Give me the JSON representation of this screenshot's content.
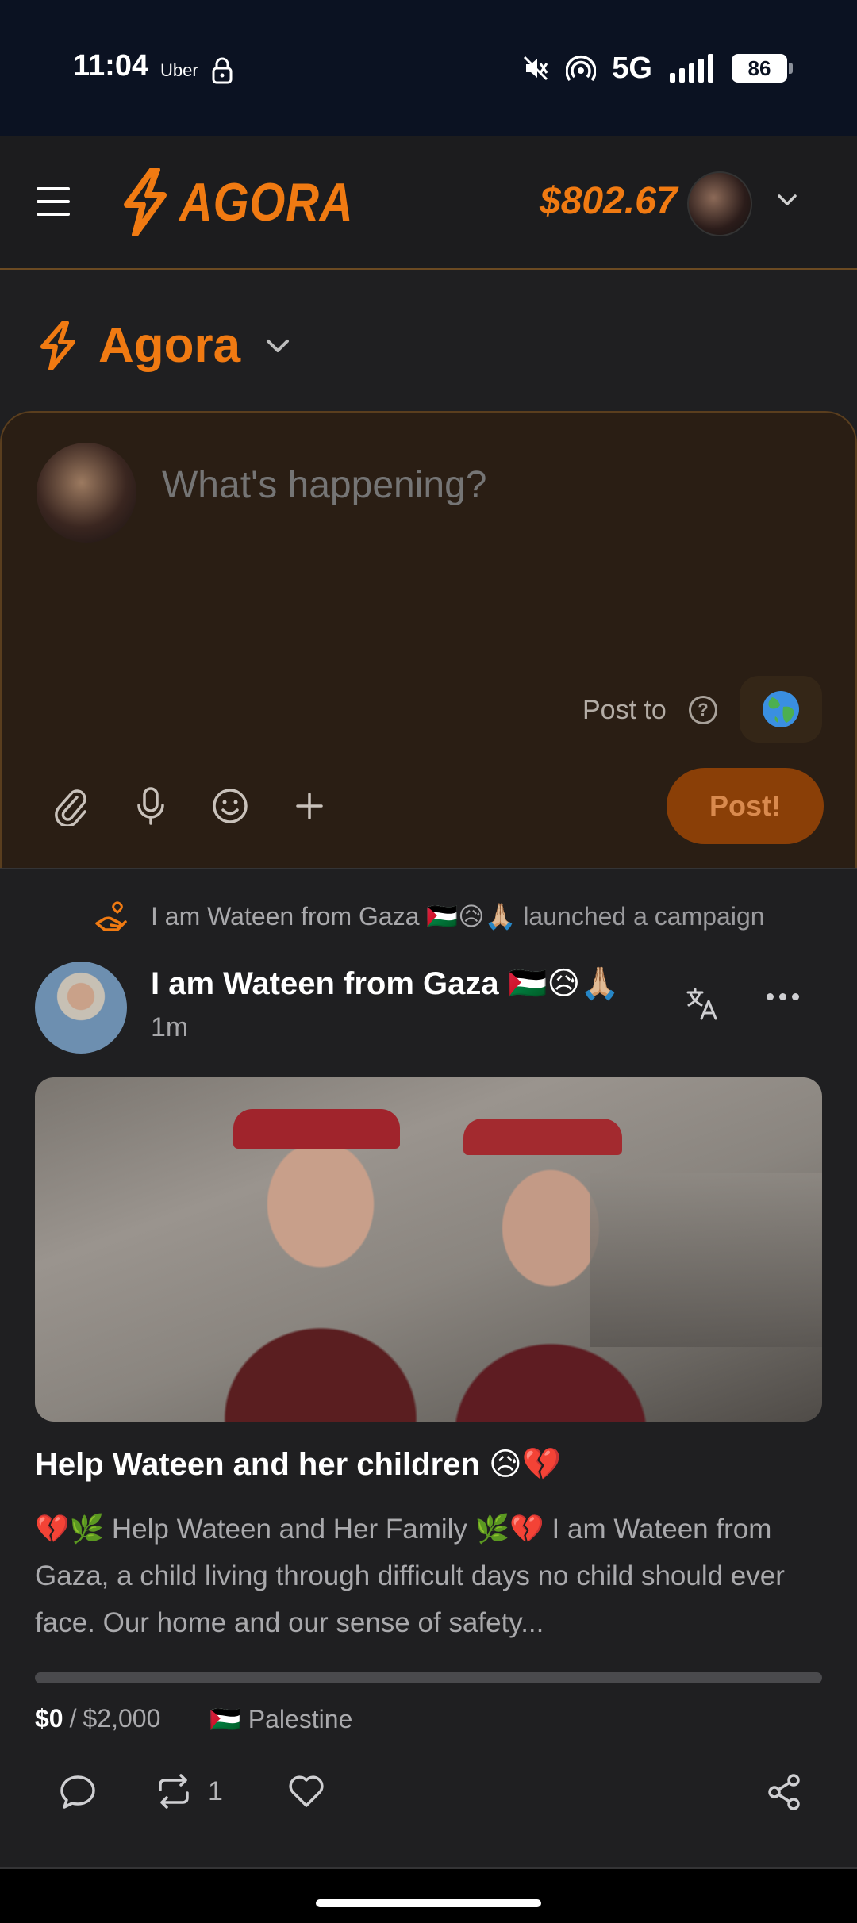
{
  "status_bar": {
    "time": "11:04",
    "notification_app": "Uber",
    "network": "5G",
    "battery": "86"
  },
  "header": {
    "logo_text": "AGORA",
    "balance": "$802.67",
    "accent_color": "#f07a12"
  },
  "community": {
    "name": "Agora"
  },
  "composer": {
    "placeholder": "What's happening?",
    "post_to_label": "Post to",
    "post_button": "Post!",
    "audience_icon": "globe-icon",
    "tools": [
      "paperclip-icon",
      "microphone-icon",
      "emoji-icon",
      "plus-icon"
    ]
  },
  "post": {
    "activity_name": "I am Wateen from Gaza 🇵🇸😥🙏🏼",
    "activity_action": "launched a campaign",
    "author_name": "I am Wateen from Gaza 🇵🇸😥🙏🏼",
    "time_ago": "1m",
    "title": "Help Wateen and her children 😥💔",
    "body": "💔🌿 Help Wateen and Her Family 🌿💔 I am Wateen from Gaza, a child living through difficult days no child should ever face. Our home and our sense of safety...",
    "raised": "$0",
    "goal": "$2,000",
    "progress_fraction": 0,
    "location_flag": "🇵🇸",
    "location": "Palestine",
    "repost_count": "1"
  }
}
